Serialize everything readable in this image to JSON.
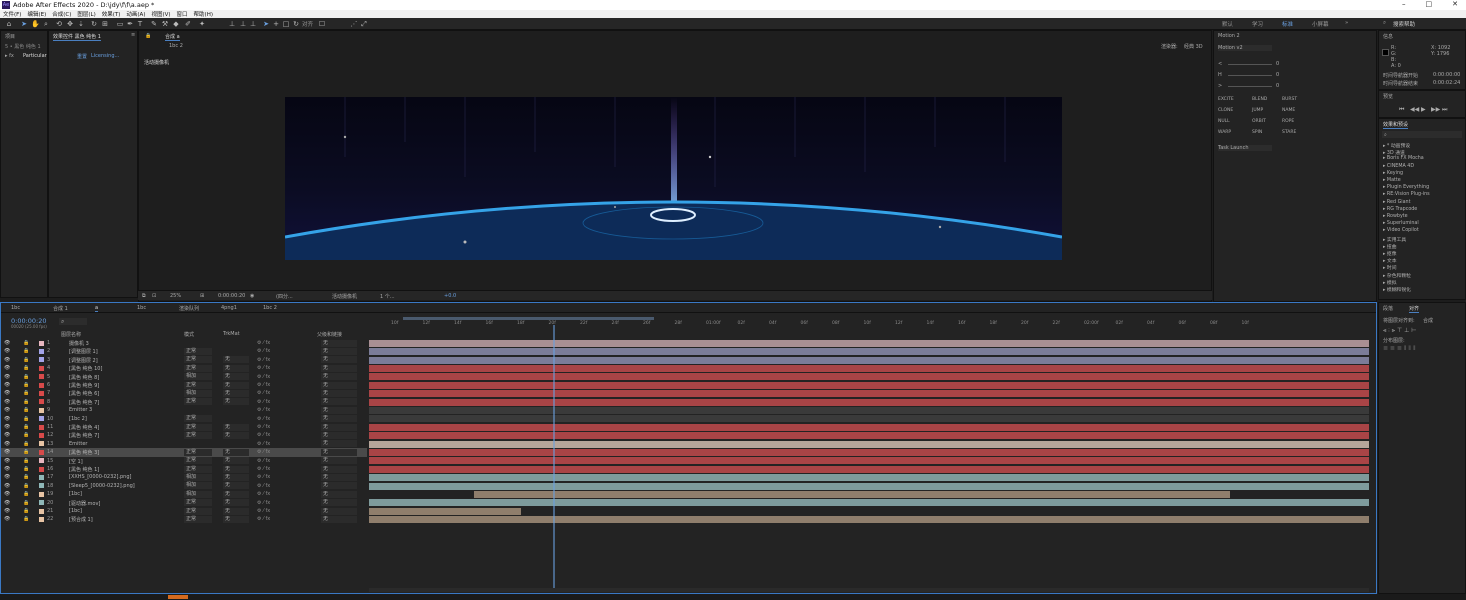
{
  "titlebar": {
    "title": "Adobe After Effects 2020 - D:\\jdy\\f\\f\\a.aep *",
    "logo": "Ae"
  },
  "window_controls": {
    "min": "–",
    "max": "□",
    "close": "✕"
  },
  "menu": [
    "文件(F)",
    "编辑(E)",
    "合成(C)",
    "图层(L)",
    "效果(T)",
    "动画(A)",
    "视图(V)",
    "窗口",
    "帮助(H)"
  ],
  "toolbar": {
    "snap_label": "对齐",
    "workspaces": [
      "默认",
      "学习",
      "标准",
      "小屏幕"
    ],
    "active_workspace": "标准",
    "search_placeholder": "搜索帮助"
  },
  "project_panel": {
    "tab": "项目",
    "item": "效果控件 黑色 纯色 1",
    "sub": "5 • 黑色 纯色 1"
  },
  "effects_controls": {
    "tab": "效果控件 黑色 纯色 1",
    "layer": "a • 黑色 纯色 1",
    "effect_name": "Particular",
    "reset": "重置",
    "licensing": "Licensing..."
  },
  "composition": {
    "tab": "合成 a",
    "breadcrumb": "1bc 2",
    "renderer_label": "渲染器:",
    "renderer_value": "经典 3D",
    "active_camera": "活动摄像机",
    "footer": {
      "zoom": "25%",
      "timecode": "0:00:00:20",
      "resolution": "(四分...",
      "view": "活动摄像机",
      "views": "1 个...",
      "offset": "+0.0"
    }
  },
  "motion_panel": {
    "title": "Motion 2",
    "version": "Motion v2",
    "sliders": [
      {
        "label": "<",
        "value": "0"
      },
      {
        "label": "H",
        "value": "0"
      },
      {
        "label": ">",
        "value": "0"
      }
    ],
    "buttons": [
      "EXCITE",
      "BLEND",
      "BURST",
      "CLONE",
      "JUMP",
      "NAME",
      "NULL",
      "ORBIT",
      "ROPE",
      "WARP",
      "SPIN",
      "STARE"
    ],
    "dropdown": "Task Launch"
  },
  "info_panel": {
    "tab": "信息",
    "x": "X: 1092",
    "y": "Y: 1796",
    "labels": [
      "R:",
      "G:",
      "B:",
      "A: 0"
    ],
    "duration_label": "时间导航器开始",
    "start": "0:00:00:00",
    "end_label": "时间导航器结束",
    "end": "0:00:02:24"
  },
  "preview_panel": {
    "tab": "预览"
  },
  "effects_presets": {
    "tab": "效果和预设",
    "search_placeholder": "",
    "items": [
      "* 动画预设",
      "3D 通道",
      "Boris FX Mocha",
      "CINEMA 4D",
      "Keying",
      "Matte",
      "Plugin Everything",
      "RE:Vision Plug-ins",
      "Red Giant",
      "RG Trapcode",
      "Rowbyte",
      "Superluminal",
      "Video Copilot",
      "实用工具",
      "扭曲",
      "抠像",
      "文本",
      "时间",
      "杂色和颗粒",
      "模拟",
      "模糊和锐化"
    ]
  },
  "align_panel": {
    "tabs": [
      "段落",
      "对齐"
    ],
    "active_tab": "对齐",
    "align_to_label": "将图层对齐到:",
    "align_to_value": "合成",
    "distribute_label": "分布图层:"
  },
  "timeline": {
    "tabs": [
      "1bc",
      "合成 1",
      "a",
      "1bc",
      "渲染队列",
      "4png1",
      "1bc 2"
    ],
    "active_tab": "a",
    "timecode": "0:00:00:20",
    "timecode_sub": "00020 (25.00 fps)",
    "columns": {
      "name": "图层名称",
      "mode": "模式",
      "trkmat": "TrkMat",
      "parent": "父级和链接"
    },
    "ruler": [
      "10f",
      "12f",
      "14f",
      "16f",
      "18f",
      "20f",
      "22f",
      "24f",
      "26f",
      "28f",
      "01:00f",
      "02f",
      "04f",
      "06f",
      "08f",
      "10f",
      "12f",
      "14f",
      "16f",
      "18f",
      "20f",
      "22f",
      "02:00f",
      "02f",
      "04f",
      "06f",
      "08f",
      "10f"
    ],
    "layers": [
      {
        "num": "1",
        "name": "摄像机 3",
        "mode": "",
        "trk": "",
        "parent": "无",
        "swatch": "#e8b7c0",
        "bar": {
          "start": 0.0,
          "end": 1.0,
          "color": "#a98f93"
        }
      },
      {
        "num": "2",
        "name": "[调整图层 1]",
        "mode": "正常",
        "trk": "",
        "parent": "无",
        "swatch": "#a4a4e8",
        "bar": {
          "start": 0.0,
          "end": 1.0,
          "color": "#7b7c98"
        }
      },
      {
        "num": "3",
        "name": "[调整图层 2]",
        "mode": "正常",
        "trk": "无",
        "parent": "无",
        "swatch": "#a4a4e8",
        "bar": {
          "start": 0.0,
          "end": 1.0,
          "color": "#7b7c98"
        }
      },
      {
        "num": "4",
        "name": "[黑色 纯色 10]",
        "mode": "正常",
        "trk": "无",
        "parent": "无",
        "swatch": "#d84a4a",
        "bar": {
          "start": 0.0,
          "end": 1.0,
          "color": "#a94446"
        }
      },
      {
        "num": "5",
        "name": "[黑色 纯色 8]",
        "mode": "相加",
        "trk": "无",
        "parent": "无",
        "swatch": "#d84a4a",
        "bar": {
          "start": 0.0,
          "end": 1.0,
          "color": "#a94446"
        }
      },
      {
        "num": "6",
        "name": "[黑色 纯色 9]",
        "mode": "正常",
        "trk": "无",
        "parent": "无",
        "swatch": "#d84a4a",
        "bar": {
          "start": 0.0,
          "end": 1.0,
          "color": "#a94446"
        }
      },
      {
        "num": "7",
        "name": "[黑色 纯色 6]",
        "mode": "相加",
        "trk": "无",
        "parent": "无",
        "swatch": "#d84a4a",
        "bar": {
          "start": 0.0,
          "end": 1.0,
          "color": "#a94446"
        }
      },
      {
        "num": "8",
        "name": "[黑色 纯色 7]",
        "mode": "正常",
        "trk": "无",
        "parent": "无",
        "swatch": "#d84a4a",
        "bar": {
          "start": 0.0,
          "end": 1.0,
          "color": "#a94446"
        }
      },
      {
        "num": "9",
        "name": "Emitter 3",
        "mode": "",
        "trk": "",
        "parent": "无",
        "swatch": "#e8c4a4",
        "bar": {
          "start": 0.0,
          "end": 1.0,
          "color": "#3a3a3a"
        }
      },
      {
        "num": "10",
        "name": "[1bc 2]",
        "mode": "正常",
        "trk": "",
        "parent": "无",
        "swatch": "#a4a4e8",
        "bar": {
          "start": 0.0,
          "end": 1.0,
          "color": "#3a3a3a"
        }
      },
      {
        "num": "11",
        "name": "[黑色 纯色 4]",
        "mode": "正常",
        "trk": "无",
        "parent": "无",
        "swatch": "#d84a4a",
        "bar": {
          "start": 0.0,
          "end": 1.0,
          "color": "#a94446"
        }
      },
      {
        "num": "12",
        "name": "[黑色 纯色 7]",
        "mode": "正常",
        "trk": "无",
        "parent": "无",
        "swatch": "#d84a4a",
        "bar": {
          "start": 0.0,
          "end": 1.0,
          "color": "#a94446"
        }
      },
      {
        "num": "13",
        "name": "Emitter",
        "mode": "",
        "trk": "",
        "parent": "无",
        "swatch": "#e8c4a4",
        "bar": {
          "start": 0.0,
          "end": 1.0,
          "color": "#b6a59a"
        }
      },
      {
        "num": "14",
        "name": "[黑色 纯色 3]",
        "mode": "正常",
        "trk": "无",
        "parent": "无",
        "swatch": "#d84a4a",
        "bar": {
          "start": 0.0,
          "end": 1.0,
          "color": "#a94446"
        },
        "selected": true
      },
      {
        "num": "15",
        "name": "[空 1]",
        "mode": "正常",
        "trk": "无",
        "parent": "无",
        "swatch": "#e8b7c0",
        "bar": {
          "start": 0.0,
          "end": 1.0,
          "color": "#a94446"
        }
      },
      {
        "num": "16",
        "name": "[黑色 纯色 1]",
        "mode": "正常",
        "trk": "无",
        "parent": "无",
        "swatch": "#d84a4a",
        "bar": {
          "start": 0.0,
          "end": 1.0,
          "color": "#a94446"
        }
      },
      {
        "num": "17",
        "name": "[XXHS_[0000-0232].png]",
        "mode": "相加",
        "trk": "无",
        "parent": "无",
        "swatch": "#8fb8b8",
        "bar": {
          "start": 0.0,
          "end": 1.0,
          "color": "#7e9b9c"
        }
      },
      {
        "num": "18",
        "name": "[Sleep5_[0000-0232].png]",
        "mode": "相加",
        "trk": "无",
        "parent": "无",
        "swatch": "#8fb8b8",
        "bar": {
          "start": 0.0,
          "end": 1.0,
          "color": "#7e9b9c"
        }
      },
      {
        "num": "19",
        "name": "[1bc]",
        "mode": "相加",
        "trk": "无",
        "parent": "无",
        "swatch": "#e8c4a4",
        "bar": {
          "start": 0.105,
          "end": 0.861,
          "color": "#8f7e6c"
        }
      },
      {
        "num": "20",
        "name": "[驱动器.mov]",
        "mode": "正常",
        "trk": "无",
        "parent": "无",
        "swatch": "#8fb8b8",
        "bar": {
          "start": 0.0,
          "end": 1.0,
          "color": "#7e9b9c"
        }
      },
      {
        "num": "21",
        "name": "[1bc]",
        "mode": "正常",
        "trk": "无",
        "parent": "无",
        "swatch": "#e8c4a4",
        "bar": {
          "start": 0.0,
          "end": 0.152,
          "color": "#8f7e6c"
        }
      },
      {
        "num": "22",
        "name": "[预合成 1]",
        "mode": "正常",
        "trk": "无",
        "parent": "无",
        "swatch": "#e8c4a4",
        "bar": {
          "start": 0.0,
          "end": 1.0,
          "color": "#8f7e6c"
        }
      }
    ],
    "playhead": 0.184,
    "work_area": {
      "start": 0.034,
      "end": 0.285
    }
  },
  "icons": {
    "eye": "eye-icon",
    "lock": "lock-icon",
    "search": "search-icon"
  },
  "colors": {
    "accent": "#3a78c4",
    "playhead": "#6aa0e0"
  }
}
